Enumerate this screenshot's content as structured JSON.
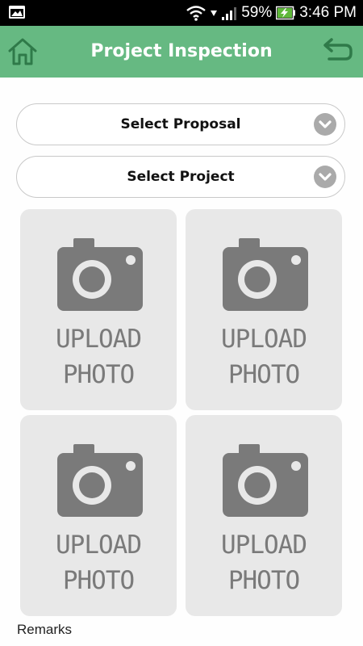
{
  "status_bar": {
    "battery": "59%",
    "time": "3:46 PM"
  },
  "header": {
    "title": "Project Inspection"
  },
  "selects": [
    {
      "label": "Select Proposal"
    },
    {
      "label": "Select Project"
    }
  ],
  "photos": [
    {
      "line1": "UPLOAD",
      "line2": "PHOTO"
    },
    {
      "line1": "UPLOAD",
      "line2": "PHOTO"
    },
    {
      "line1": "UPLOAD",
      "line2": "PHOTO"
    },
    {
      "line1": "UPLOAD",
      "line2": "PHOTO"
    }
  ],
  "remarks_label": "Remarks",
  "colors": {
    "header_bg": "#66b982",
    "status_bg": "#000000",
    "tile_bg": "#e8e8e8",
    "battery_fill": "#5fb83a"
  },
  "icons": {
    "home": "home-icon",
    "back": "back-arrow-icon",
    "dropdown": "chevron-down-icon",
    "camera": "camera-icon"
  }
}
